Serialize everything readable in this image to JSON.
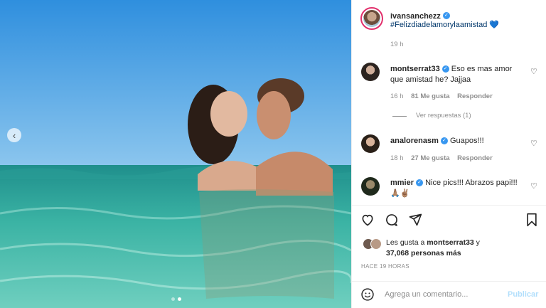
{
  "post": {
    "author": "ivansanchezz",
    "caption_hashtag": "#Felizdiadelamorylaamistad",
    "caption_emoji": "💙",
    "caption_time": "19 h"
  },
  "comments": [
    {
      "user": "montserrat33",
      "text_line1": "Eso es mas amor",
      "text_line2": "que amistad he? Jajjaa",
      "time": "16 h",
      "likes": "81 Me gusta",
      "reply": "Responder",
      "replies_link": "Ver respuestas (1)"
    },
    {
      "user": "analorenasm",
      "text_line1": "Guapos!!!",
      "time": "18 h",
      "likes": "27 Me gusta",
      "reply": "Responder"
    },
    {
      "user": "mmier",
      "text_line1": "Nice pics!!! Abrazos papi!!!",
      "text_line2": "🙏🏽✌🏽"
    }
  ],
  "likes_summary": {
    "prefix": "Les gusta a ",
    "first_user": "montserrat33",
    "suffix": " y",
    "count_line": "37,068 personas más"
  },
  "timestamp": "HACE 19 HORAS",
  "composer": {
    "placeholder": "Agrega un comentario...",
    "publish": "Publicar"
  },
  "carousel": {
    "total": 2,
    "active": 2
  },
  "colors": {
    "verified": "#3897f0",
    "link": "#00376b",
    "publish": "#b2dffc"
  }
}
